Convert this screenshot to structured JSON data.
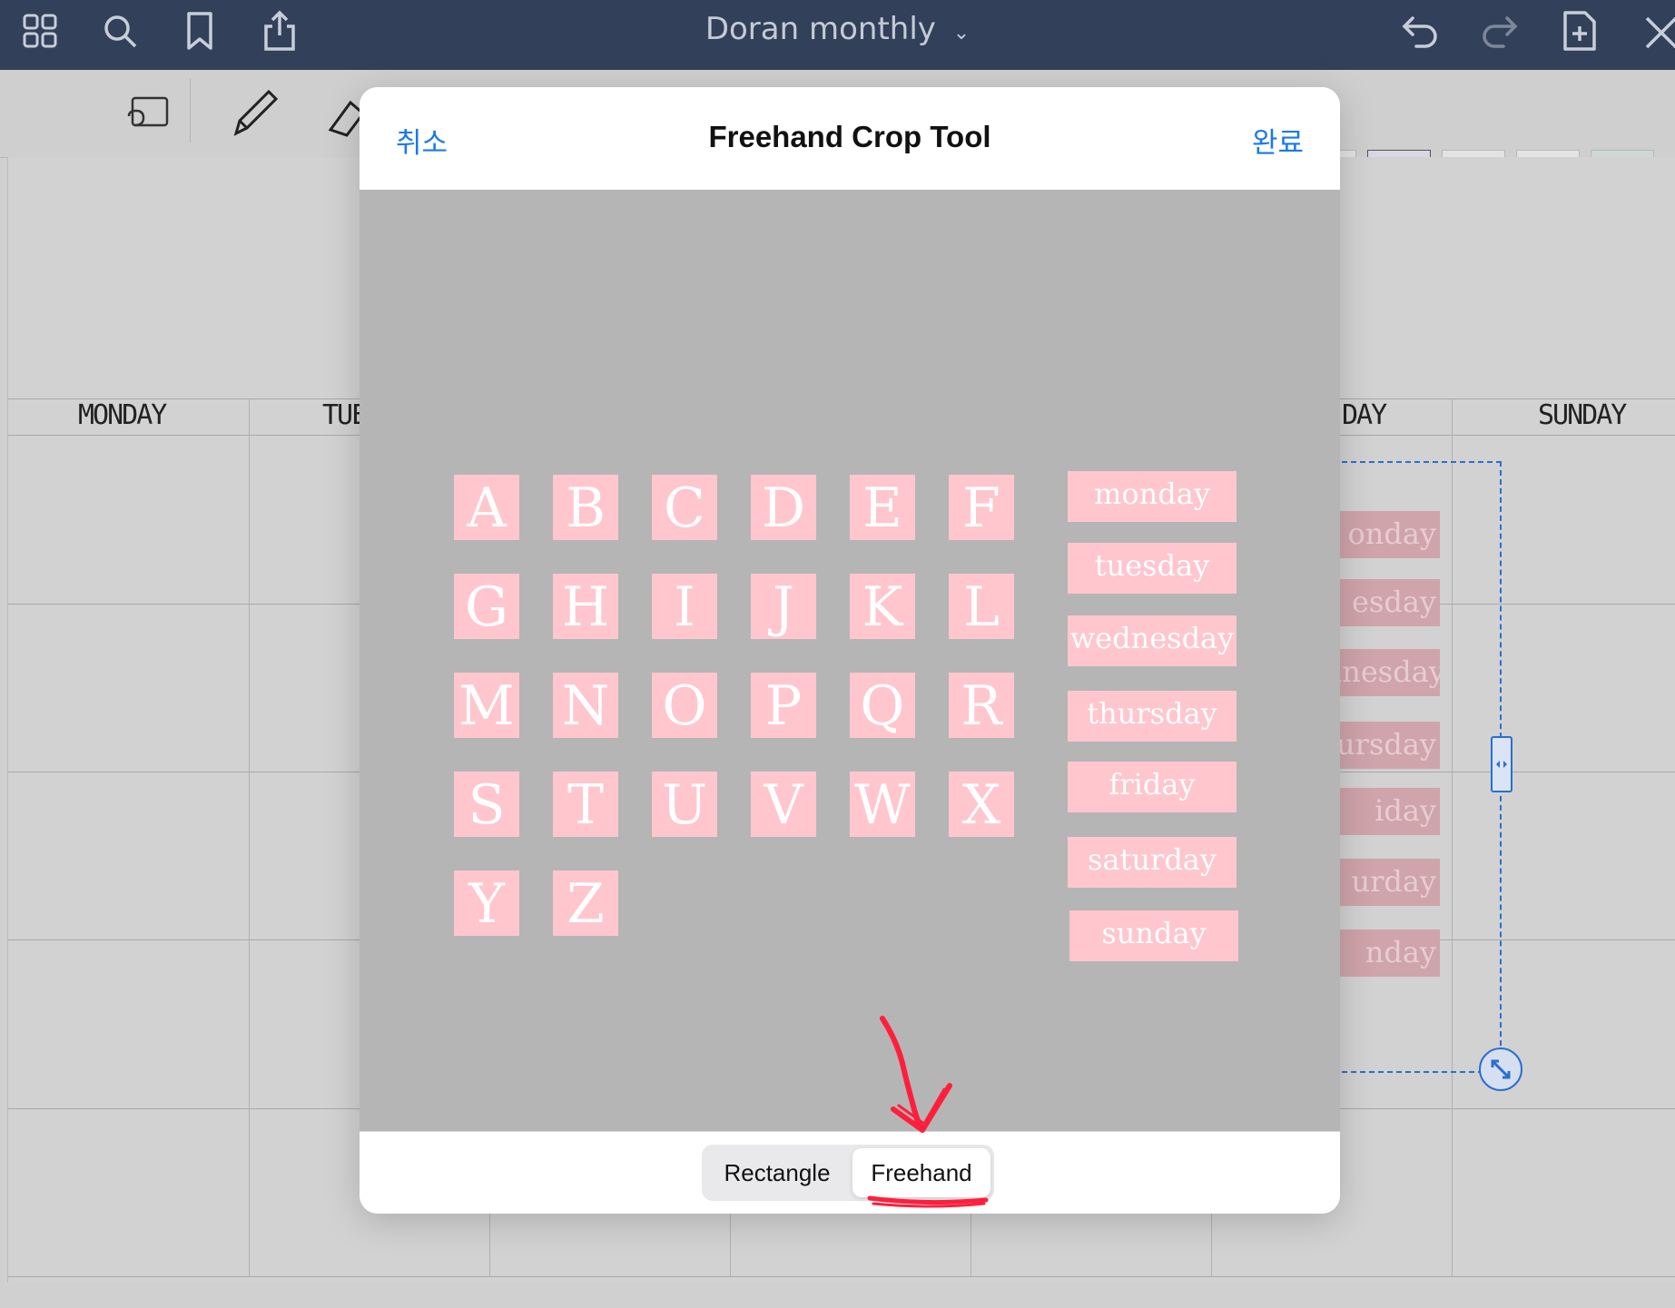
{
  "topbar": {
    "title": "Doran monthly",
    "icons": [
      "grid-icon",
      "search-icon",
      "bookmark-icon",
      "share-icon",
      "undo-icon",
      "redo-icon",
      "add-page-icon",
      "close-icon"
    ]
  },
  "planner": {
    "days": [
      "MONDAY",
      "TUES",
      "DAY",
      "SUNDAY"
    ],
    "background_tags": [
      "onday",
      "esday",
      "lnesday",
      "ursday",
      "iday",
      "urday",
      "nday"
    ]
  },
  "modal": {
    "title": "Freehand Crop Tool",
    "cancel": "취소",
    "done": "완료",
    "letters": [
      "A",
      "B",
      "C",
      "D",
      "E",
      "F",
      "G",
      "H",
      "I",
      "J",
      "K",
      "L",
      "M",
      "N",
      "O",
      "P",
      "Q",
      "R",
      "S",
      "T",
      "U",
      "V",
      "W",
      "X",
      "Y",
      "Z"
    ],
    "day_tags": [
      "monday",
      "tuesday",
      "wednesday",
      "thursday",
      "friday",
      "saturday",
      "sunday"
    ],
    "segment": {
      "options": [
        "Rectangle",
        "Freehand"
      ],
      "selected": "Freehand"
    }
  },
  "colors": {
    "topbar": "#33405a",
    "accent": "#1a7ae6",
    "sticker_pink": "#ffc6ce",
    "annotation_red": "#ff1f3d",
    "canvas_gray": "#b5b5b5"
  }
}
